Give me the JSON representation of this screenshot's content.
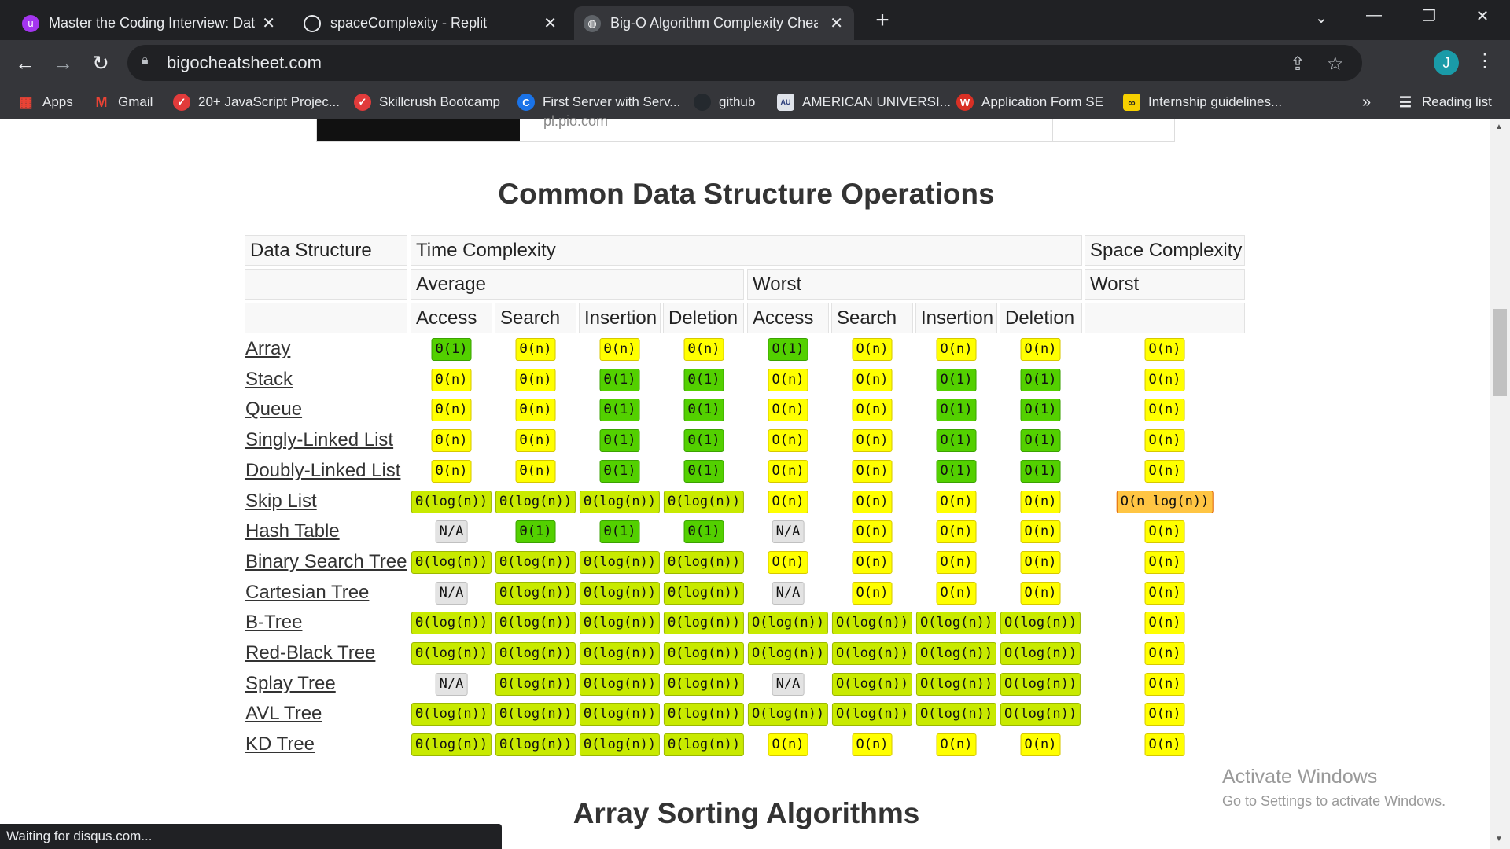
{
  "browser": {
    "tabs": [
      {
        "title": "Master the Coding Interview: Data S",
        "icon": "udemy-icon",
        "active": false
      },
      {
        "title": "spaceComplexity - Replit",
        "icon": "replit-icon",
        "active": false
      },
      {
        "title": "Big-O Algorithm Complexity Cheat S",
        "icon": "globe-icon",
        "active": true
      }
    ],
    "url": "bigocheatsheet.com",
    "avatar_letter": "J",
    "bookmarks": [
      "Apps",
      "Gmail",
      "20+ JavaScript Projec...",
      "Skillcrush Bootcamp",
      "First Server with Serv...",
      "github",
      "AMERICAN UNIVERSI...",
      "Application Form SE",
      "Internship guidelines..."
    ],
    "bookmarks_more": "»",
    "reading_list": "Reading list"
  },
  "ad_strip_text": "pl.pio.com",
  "section_title": "Common Data Structure Operations",
  "next_section_title": "Array Sorting Algorithms",
  "table": {
    "header": {
      "data_structure": "Data Structure",
      "time_complexity": "Time Complexity",
      "space_complexity": "Space Complexity",
      "average": "Average",
      "worst": "Worst",
      "space_worst": "Worst",
      "ops": [
        "Access",
        "Search",
        "Insertion",
        "Deletion",
        "Access",
        "Search",
        "Insertion",
        "Deletion"
      ]
    },
    "legend_colors": {
      "good": "#53d000",
      "fair": "#c8ea00",
      "bad": "#ffff00",
      "horrible": "#ffc543",
      "na": "#e3e3e3"
    },
    "rows": [
      {
        "name": "Array",
        "cells": [
          [
            "Θ(1)",
            "good"
          ],
          [
            "Θ(n)",
            "bad"
          ],
          [
            "Θ(n)",
            "bad"
          ],
          [
            "Θ(n)",
            "bad"
          ],
          [
            "O(1)",
            "good"
          ],
          [
            "O(n)",
            "bad"
          ],
          [
            "O(n)",
            "bad"
          ],
          [
            "O(n)",
            "bad"
          ],
          [
            "O(n)",
            "bad"
          ]
        ]
      },
      {
        "name": "Stack",
        "cells": [
          [
            "Θ(n)",
            "bad"
          ],
          [
            "Θ(n)",
            "bad"
          ],
          [
            "Θ(1)",
            "good"
          ],
          [
            "Θ(1)",
            "good"
          ],
          [
            "O(n)",
            "bad"
          ],
          [
            "O(n)",
            "bad"
          ],
          [
            "O(1)",
            "good"
          ],
          [
            "O(1)",
            "good"
          ],
          [
            "O(n)",
            "bad"
          ]
        ]
      },
      {
        "name": "Queue",
        "cells": [
          [
            "Θ(n)",
            "bad"
          ],
          [
            "Θ(n)",
            "bad"
          ],
          [
            "Θ(1)",
            "good"
          ],
          [
            "Θ(1)",
            "good"
          ],
          [
            "O(n)",
            "bad"
          ],
          [
            "O(n)",
            "bad"
          ],
          [
            "O(1)",
            "good"
          ],
          [
            "O(1)",
            "good"
          ],
          [
            "O(n)",
            "bad"
          ]
        ]
      },
      {
        "name": "Singly-Linked List",
        "cells": [
          [
            "Θ(n)",
            "bad"
          ],
          [
            "Θ(n)",
            "bad"
          ],
          [
            "Θ(1)",
            "good"
          ],
          [
            "Θ(1)",
            "good"
          ],
          [
            "O(n)",
            "bad"
          ],
          [
            "O(n)",
            "bad"
          ],
          [
            "O(1)",
            "good"
          ],
          [
            "O(1)",
            "good"
          ],
          [
            "O(n)",
            "bad"
          ]
        ]
      },
      {
        "name": "Doubly-Linked List",
        "cells": [
          [
            "Θ(n)",
            "bad"
          ],
          [
            "Θ(n)",
            "bad"
          ],
          [
            "Θ(1)",
            "good"
          ],
          [
            "Θ(1)",
            "good"
          ],
          [
            "O(n)",
            "bad"
          ],
          [
            "O(n)",
            "bad"
          ],
          [
            "O(1)",
            "good"
          ],
          [
            "O(1)",
            "good"
          ],
          [
            "O(n)",
            "bad"
          ]
        ]
      },
      {
        "name": "Skip List",
        "cells": [
          [
            "Θ(log(n))",
            "fair"
          ],
          [
            "Θ(log(n))",
            "fair"
          ],
          [
            "Θ(log(n))",
            "fair"
          ],
          [
            "Θ(log(n))",
            "fair"
          ],
          [
            "O(n)",
            "bad"
          ],
          [
            "O(n)",
            "bad"
          ],
          [
            "O(n)",
            "bad"
          ],
          [
            "O(n)",
            "bad"
          ],
          [
            "O(n log(n))",
            "horrible"
          ]
        ]
      },
      {
        "name": "Hash Table",
        "cells": [
          [
            "N/A",
            "na"
          ],
          [
            "Θ(1)",
            "good"
          ],
          [
            "Θ(1)",
            "good"
          ],
          [
            "Θ(1)",
            "good"
          ],
          [
            "N/A",
            "na"
          ],
          [
            "O(n)",
            "bad"
          ],
          [
            "O(n)",
            "bad"
          ],
          [
            "O(n)",
            "bad"
          ],
          [
            "O(n)",
            "bad"
          ]
        ]
      },
      {
        "name": "Binary Search Tree",
        "cells": [
          [
            "Θ(log(n))",
            "fair"
          ],
          [
            "Θ(log(n))",
            "fair"
          ],
          [
            "Θ(log(n))",
            "fair"
          ],
          [
            "Θ(log(n))",
            "fair"
          ],
          [
            "O(n)",
            "bad"
          ],
          [
            "O(n)",
            "bad"
          ],
          [
            "O(n)",
            "bad"
          ],
          [
            "O(n)",
            "bad"
          ],
          [
            "O(n)",
            "bad"
          ]
        ]
      },
      {
        "name": "Cartesian Tree",
        "cells": [
          [
            "N/A",
            "na"
          ],
          [
            "Θ(log(n))",
            "fair"
          ],
          [
            "Θ(log(n))",
            "fair"
          ],
          [
            "Θ(log(n))",
            "fair"
          ],
          [
            "N/A",
            "na"
          ],
          [
            "O(n)",
            "bad"
          ],
          [
            "O(n)",
            "bad"
          ],
          [
            "O(n)",
            "bad"
          ],
          [
            "O(n)",
            "bad"
          ]
        ]
      },
      {
        "name": "B-Tree",
        "cells": [
          [
            "Θ(log(n))",
            "fair"
          ],
          [
            "Θ(log(n))",
            "fair"
          ],
          [
            "Θ(log(n))",
            "fair"
          ],
          [
            "Θ(log(n))",
            "fair"
          ],
          [
            "O(log(n))",
            "fair"
          ],
          [
            "O(log(n))",
            "fair"
          ],
          [
            "O(log(n))",
            "fair"
          ],
          [
            "O(log(n))",
            "fair"
          ],
          [
            "O(n)",
            "bad"
          ]
        ]
      },
      {
        "name": "Red-Black Tree",
        "cells": [
          [
            "Θ(log(n))",
            "fair"
          ],
          [
            "Θ(log(n))",
            "fair"
          ],
          [
            "Θ(log(n))",
            "fair"
          ],
          [
            "Θ(log(n))",
            "fair"
          ],
          [
            "O(log(n))",
            "fair"
          ],
          [
            "O(log(n))",
            "fair"
          ],
          [
            "O(log(n))",
            "fair"
          ],
          [
            "O(log(n))",
            "fair"
          ],
          [
            "O(n)",
            "bad"
          ]
        ]
      },
      {
        "name": "Splay Tree",
        "cells": [
          [
            "N/A",
            "na"
          ],
          [
            "Θ(log(n))",
            "fair"
          ],
          [
            "Θ(log(n))",
            "fair"
          ],
          [
            "Θ(log(n))",
            "fair"
          ],
          [
            "N/A",
            "na"
          ],
          [
            "O(log(n))",
            "fair"
          ],
          [
            "O(log(n))",
            "fair"
          ],
          [
            "O(log(n))",
            "fair"
          ],
          [
            "O(n)",
            "bad"
          ]
        ]
      },
      {
        "name": "AVL Tree",
        "cells": [
          [
            "Θ(log(n))",
            "fair"
          ],
          [
            "Θ(log(n))",
            "fair"
          ],
          [
            "Θ(log(n))",
            "fair"
          ],
          [
            "Θ(log(n))",
            "fair"
          ],
          [
            "O(log(n))",
            "fair"
          ],
          [
            "O(log(n))",
            "fair"
          ],
          [
            "O(log(n))",
            "fair"
          ],
          [
            "O(log(n))",
            "fair"
          ],
          [
            "O(n)",
            "bad"
          ]
        ]
      },
      {
        "name": "KD Tree",
        "cells": [
          [
            "Θ(log(n))",
            "fair"
          ],
          [
            "Θ(log(n))",
            "fair"
          ],
          [
            "Θ(log(n))",
            "fair"
          ],
          [
            "Θ(log(n))",
            "fair"
          ],
          [
            "O(n)",
            "bad"
          ],
          [
            "O(n)",
            "bad"
          ],
          [
            "O(n)",
            "bad"
          ],
          [
            "O(n)",
            "bad"
          ],
          [
            "O(n)",
            "bad"
          ]
        ]
      }
    ]
  },
  "watermark": {
    "line1": "Activate Windows",
    "line2": "Go to Settings to activate Windows."
  },
  "status_text": "Waiting for disqus.com..."
}
